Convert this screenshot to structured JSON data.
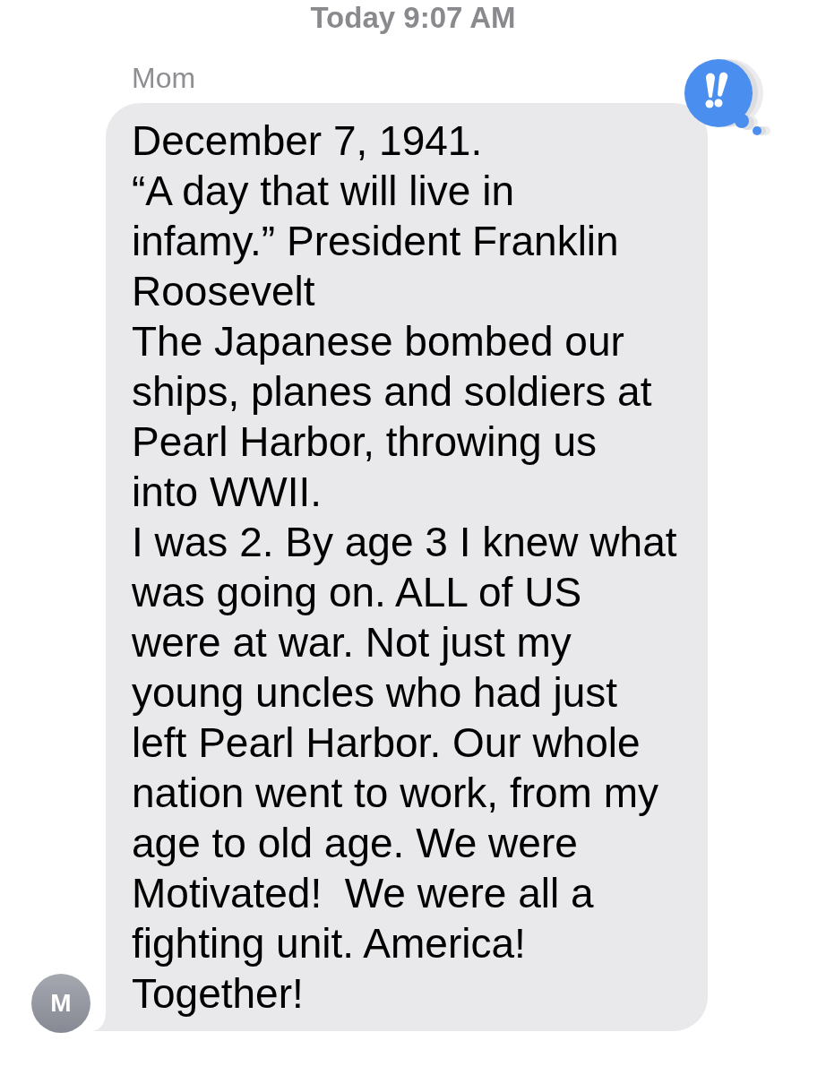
{
  "timestamp": "Today 9:07 AM",
  "messages": [
    {
      "sender": "Mom",
      "avatar_initial": "M",
      "emphasized": true,
      "text": "December 7, 1941.\n“A day that will live in\ninfamy.” President Franklin\nRoosevelt\nThe Japanese bombed our\nships, planes and soldiers at\nPearl Harbor, throwing us\ninto WWII.\nI was 2. By age 3 I knew what\nwas going on. ALL of US\nwere at war. Not just my\nyoung uncles who had just\nleft Pearl Harbor. Our whole\nnation went to work, from my\nage to old age. We were\nMotivated!  We were all a\nfighting unit. America!\nTogether!"
    }
  ]
}
